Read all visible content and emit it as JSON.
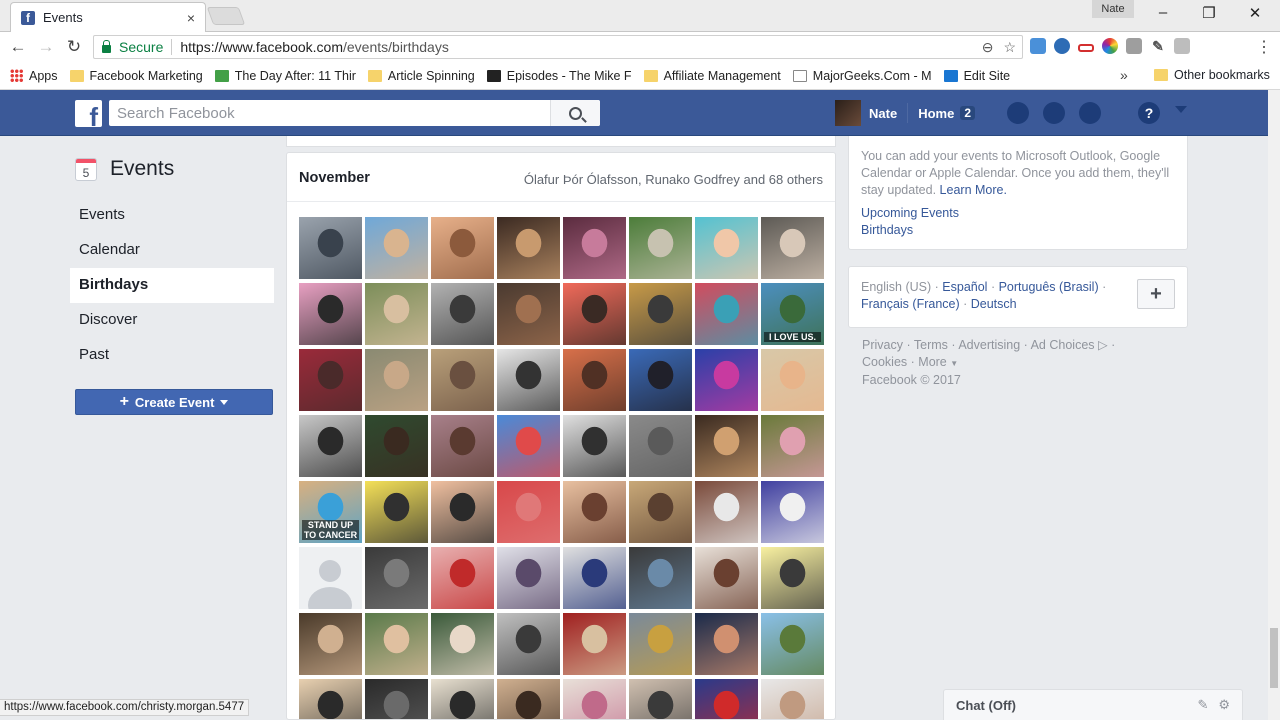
{
  "browser": {
    "tab_title": "Events",
    "tab_close": "×",
    "window_user": "Nate",
    "secure_label": "Secure",
    "url_base": "https://www.facebook.com",
    "url_path": "/events/birthdays",
    "status_url": "https://www.facebook.com/christy.morgan.5477"
  },
  "bookmarks": [
    {
      "label": "Apps",
      "icon": "apps-grid-icon"
    },
    {
      "label": "Facebook Marketing",
      "icon": "folder-icon"
    },
    {
      "label": "The Day After: 11 Thir",
      "icon": "page-icon"
    },
    {
      "label": "Article Spinning",
      "icon": "folder-icon"
    },
    {
      "label": "Episodes - The Mike F",
      "icon": "page-icon"
    },
    {
      "label": "Affiliate Management",
      "icon": "folder-icon"
    },
    {
      "label": "MajorGeeks.Com - M",
      "icon": "page-icon"
    },
    {
      "label": "Edit Site",
      "icon": "page-icon"
    }
  ],
  "bookmarks_overflow": "»",
  "other_bookmarks": "Other bookmarks",
  "facebook": {
    "search_placeholder": "Search Facebook",
    "user_name": "Nate",
    "home_label": "Home",
    "home_badge": "2"
  },
  "sidebar": {
    "heading": "Events",
    "calendar_day": "5",
    "items": [
      {
        "label": "Events",
        "active": false
      },
      {
        "label": "Calendar",
        "active": false
      },
      {
        "label": "Birthdays",
        "active": true
      },
      {
        "label": "Discover",
        "active": false
      },
      {
        "label": "Past",
        "active": false
      }
    ],
    "create_label": "Create Event"
  },
  "main": {
    "month": "November",
    "people_summary": "Ólafur Þór Ólafsson, Runako Godfrey and 68 others",
    "photo_captions": {
      "15": "I LOVE US.",
      "32": "STAND UP TO CANCER"
    }
  },
  "right": {
    "calendar_text": "You can add your events to Microsoft Outlook, Google Calendar or Apple Calendar. Once you add them, they'll stay updated.",
    "learn_more": "Learn More.",
    "upcoming_link": "Upcoming Events",
    "birthdays_link": "Birthdays",
    "languages": {
      "current": "English (US)",
      "others": [
        "Español",
        "Português (Brasil)",
        "Français (France)",
        "Deutsch"
      ]
    },
    "footer_links": [
      "Privacy",
      "Terms",
      "Advertising",
      "Ad Choices",
      "Cookies",
      "More"
    ],
    "copyright": "Facebook © 2017"
  },
  "chat": {
    "label": "Chat (Off)"
  }
}
